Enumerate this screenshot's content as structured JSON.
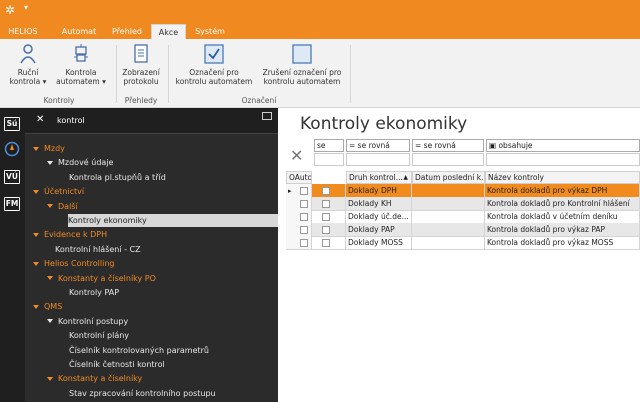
{
  "titlebar": {
    "logo_icon": "helios-logo-icon",
    "quick_access": "▾"
  },
  "menu": {
    "tabs": [
      {
        "label": "HELIOS"
      },
      {
        "label": "Automat"
      },
      {
        "label": "Přehled"
      },
      {
        "label": "Akce",
        "active": true
      },
      {
        "label": "Systém"
      }
    ]
  },
  "ribbon": {
    "buttons": {
      "rucni": "Ruční kontrola ▾",
      "kontrola_automatem": "Kontrola automatem ▾",
      "zobrazeni": "Zobrazení protokolu",
      "oznaceni": "Označení pro kontrolu automatem",
      "zruseni": "Zrušení označení pro kontrolu automatem"
    },
    "groups": {
      "kontroly": "Kontroly",
      "prehledy": "Přehledy",
      "oznaceni": "Označení"
    }
  },
  "leftbar": {
    "items": [
      "Sú",
      "",
      "VÚ",
      "FM"
    ]
  },
  "nav": {
    "search_text": "kontrol",
    "items": [
      {
        "label": "Mzdy",
        "style": "orange",
        "indent": 0,
        "arrow": true
      },
      {
        "label": "Mzdové údaje",
        "style": "white",
        "indent": 1,
        "arrow": true
      },
      {
        "label": "Kontrola pl.stupňů a tříd",
        "style": "white",
        "indent": 2
      },
      {
        "label": "Účetnictví",
        "style": "orange",
        "indent": 0,
        "arrow": true
      },
      {
        "label": "Další",
        "style": "orange",
        "indent": 1,
        "arrow": true
      },
      {
        "label": "Kontroly ekonomiky",
        "style": "selected",
        "indent": 2
      },
      {
        "label": "Evidence k DPH",
        "style": "orange",
        "indent": 0,
        "arrow": true
      },
      {
        "label": "Kontrolní hlášení - CZ",
        "style": "white",
        "indent": 1
      },
      {
        "label": "Helios Controlling",
        "style": "orange",
        "indent": 0,
        "arrow": true
      },
      {
        "label": "Konstanty a číselníky PO",
        "style": "orange",
        "indent": 1,
        "arrow": true
      },
      {
        "label": "Kontroly PAP",
        "style": "white",
        "indent": 2
      },
      {
        "label": "QMS",
        "style": "orange",
        "indent": 0,
        "arrow": true
      },
      {
        "label": "Kontrolní postupy",
        "style": "white",
        "indent": 1,
        "arrow": true
      },
      {
        "label": "Kontrolní plány",
        "style": "white",
        "indent": 2
      },
      {
        "label": "Číselník kontrolovaných parametrů",
        "style": "white",
        "indent": 2
      },
      {
        "label": "Číselník četnosti kontrol",
        "style": "white",
        "indent": 2
      },
      {
        "label": "Konstanty a číselníky",
        "style": "orange",
        "indent": 1,
        "arrow": true
      },
      {
        "label": "Stav zpracování kontrolního postupu",
        "style": "white",
        "indent": 2
      }
    ]
  },
  "main": {
    "title": "Kontroly ekonomiky",
    "filters": [
      "se",
      "= se rovná",
      "= se rovná",
      "▣ obsahuje"
    ],
    "columns": [
      "OAuto",
      "Druh kontrol...",
      "Datum poslední k...",
      "Název kontroly"
    ],
    "rows": [
      {
        "druh": "Doklady DPH",
        "nazev": "Kontrola dokladů pro výkaz DPH",
        "selected": true
      },
      {
        "druh": "Doklady KH",
        "nazev": "Kontrola dokladů pro Kontrolní hlášení"
      },
      {
        "druh": "Doklady úč.de...",
        "nazev": "Kontrola dokladů v účetním deníku"
      },
      {
        "druh": "Doklady PAP",
        "nazev": "Kontrola dokladů pro výkaz PAP"
      },
      {
        "druh": "Doklady MOSS",
        "nazev": "Kontrola dokladů pro výkaz MOSS"
      }
    ]
  },
  "colors": {
    "accent": "#f0891f",
    "nav_bg": "#2b2b2b",
    "nav_orange": "#f08a24"
  }
}
